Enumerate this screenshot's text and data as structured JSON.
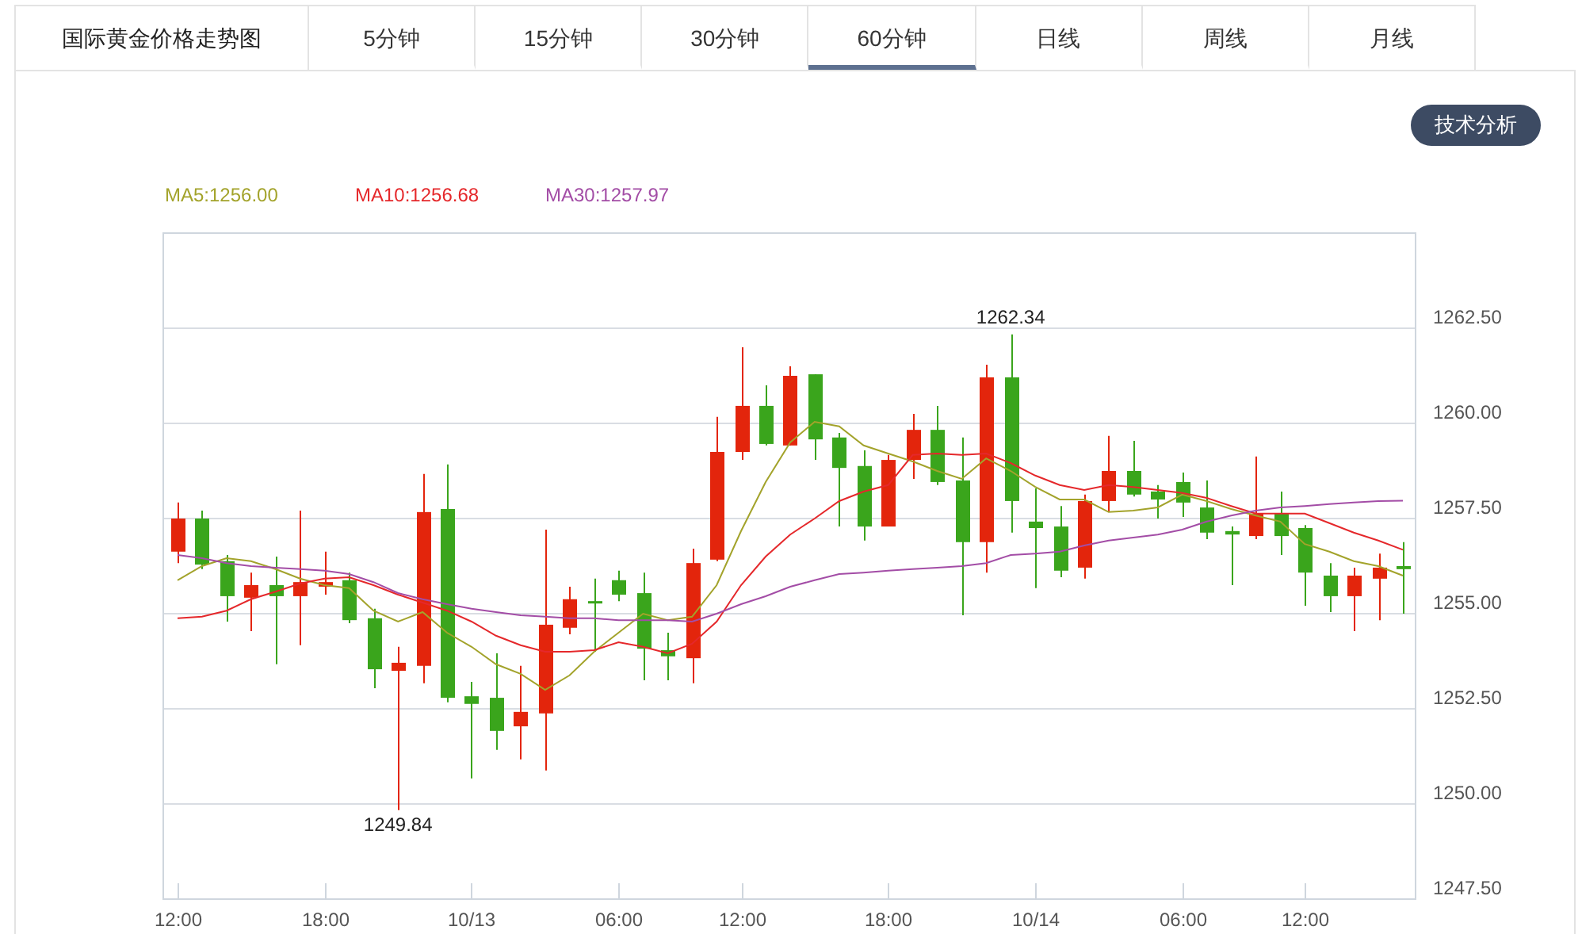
{
  "title": "国际黄金价格走势图",
  "tabs": [
    {
      "label": "5分钟",
      "selected": false
    },
    {
      "label": "15分钟",
      "selected": false
    },
    {
      "label": "30分钟",
      "selected": false
    },
    {
      "label": "60分钟",
      "selected": true
    },
    {
      "label": "日线",
      "selected": false
    },
    {
      "label": "周线",
      "selected": false
    },
    {
      "label": "月线",
      "selected": false
    }
  ],
  "analysis_button": "技术分析",
  "chart_data": {
    "type": "candlestick",
    "ylim": [
      1247.5,
      1265
    ],
    "categories": [
      "12:00",
      null,
      null,
      null,
      null,
      null,
      "18:00",
      null,
      null,
      null,
      null,
      null,
      "10/13",
      null,
      null,
      null,
      null,
      null,
      "06:00",
      null,
      null,
      null,
      null,
      "12:00",
      null,
      null,
      null,
      null,
      null,
      "18:00",
      null,
      null,
      null,
      null,
      null,
      "10/14",
      null,
      null,
      null,
      null,
      null,
      "06:00",
      null,
      null,
      null,
      null,
      "12:00",
      null,
      null,
      null,
      null
    ],
    "yticks": [
      {
        "value": 1262.5,
        "label": "1262.50"
      },
      {
        "value": 1260,
        "label": "1260.00"
      },
      {
        "value": 1257.5,
        "label": "1257.50"
      },
      {
        "value": 1255,
        "label": "1255.00"
      },
      {
        "value": 1252.5,
        "label": "1252.50"
      },
      {
        "value": 1250,
        "label": "1250.00"
      },
      {
        "value": 1247.5,
        "label": "1247.50"
      }
    ],
    "ohlc": [
      [
        1256.63,
        1257.92,
        1256.33,
        1257.5
      ],
      [
        1257.5,
        1257.71,
        1256.17,
        1256.29
      ],
      [
        1256.38,
        1256.54,
        1254.79,
        1255.46
      ],
      [
        1255.42,
        1256.08,
        1254.54,
        1255.75
      ],
      [
        1255.75,
        1256.5,
        1253.67,
        1255.46
      ],
      [
        1255.46,
        1257.71,
        1254.17,
        1255.83
      ],
      [
        1255.71,
        1256.63,
        1255.5,
        1255.83
      ],
      [
        1255.88,
        1256.08,
        1254.75,
        1254.83
      ],
      [
        1254.88,
        1255.13,
        1253.04,
        1253.54
      ],
      [
        1253.5,
        1254.13,
        1249.84,
        1253.71
      ],
      [
        1253.63,
        1258.67,
        1253.17,
        1257.67
      ],
      [
        1257.75,
        1258.92,
        1252.67,
        1252.79
      ],
      [
        1252.83,
        1253.21,
        1250.67,
        1252.63
      ],
      [
        1252.79,
        1253.96,
        1251.42,
        1251.92
      ],
      [
        1252.04,
        1253.63,
        1251.17,
        1252.42
      ],
      [
        1252.38,
        1257.21,
        1250.88,
        1254.71
      ],
      [
        1254.63,
        1255.71,
        1254.46,
        1255.38
      ],
      [
        1255.33,
        1255.92,
        1254.0,
        1255.29
      ],
      [
        1255.88,
        1256.13,
        1255.33,
        1255.5
      ],
      [
        1255.54,
        1256.08,
        1253.25,
        1254.08
      ],
      [
        1254.04,
        1254.5,
        1253.25,
        1253.88
      ],
      [
        1253.83,
        1256.71,
        1253.17,
        1256.33
      ],
      [
        1256.42,
        1260.17,
        1256.38,
        1259.25
      ],
      [
        1259.25,
        1262.0,
        1259.04,
        1260.46
      ],
      [
        1260.46,
        1261.0,
        1259.42,
        1259.46
      ],
      [
        1259.42,
        1261.5,
        1259.42,
        1261.25
      ],
      [
        1261.29,
        1261.29,
        1259.04,
        1259.58
      ],
      [
        1259.63,
        1259.75,
        1257.29,
        1258.83
      ],
      [
        1258.88,
        1259.29,
        1256.92,
        1257.29
      ],
      [
        1257.29,
        1259.17,
        1257.29,
        1259.04
      ],
      [
        1259.04,
        1260.25,
        1258.54,
        1259.83
      ],
      [
        1259.83,
        1260.46,
        1258.38,
        1258.46
      ],
      [
        1258.5,
        1259.63,
        1254.96,
        1256.88
      ],
      [
        1256.88,
        1261.54,
        1256.08,
        1261.21
      ],
      [
        1261.21,
        1262.34,
        1257.13,
        1257.96
      ],
      [
        1257.42,
        1258.29,
        1255.67,
        1257.25
      ],
      [
        1257.29,
        1257.83,
        1255.96,
        1256.13
      ],
      [
        1256.21,
        1258.13,
        1255.92,
        1257.96
      ],
      [
        1257.96,
        1259.67,
        1257.67,
        1258.75
      ],
      [
        1258.75,
        1259.54,
        1258.08,
        1258.13
      ],
      [
        1258.21,
        1258.38,
        1257.5,
        1258.0
      ],
      [
        1258.46,
        1258.71,
        1257.54,
        1257.92
      ],
      [
        1257.79,
        1258.5,
        1256.96,
        1257.13
      ],
      [
        1257.17,
        1257.29,
        1255.75,
        1257.08
      ],
      [
        1257.04,
        1259.13,
        1256.96,
        1257.63
      ],
      [
        1257.63,
        1258.21,
        1256.54,
        1257.04
      ],
      [
        1257.25,
        1257.33,
        1255.21,
        1256.08
      ],
      [
        1256.0,
        1256.33,
        1255.04,
        1255.46
      ],
      [
        1255.46,
        1256.21,
        1254.54,
        1256.0
      ],
      [
        1255.92,
        1256.58,
        1254.83,
        1256.21
      ],
      [
        1256.25,
        1256.88,
        1255.0,
        1256.17
      ]
    ],
    "series": [
      {
        "name": "MA5:1256.00",
        "type": "line",
        "color": "#a3a32b",
        "values": [
          1255.88,
          1256.25,
          1256.46,
          1256.38,
          1256.17,
          1255.92,
          1255.75,
          1255.67,
          1255.08,
          1254.79,
          1255.04,
          1254.5,
          1254.13,
          1253.67,
          1253.42,
          1253.0,
          1253.38,
          1254.0,
          1254.5,
          1255.0,
          1254.83,
          1254.92,
          1255.75,
          1257.17,
          1258.46,
          1259.5,
          1260.04,
          1259.92,
          1259.42,
          1259.21,
          1259.0,
          1258.75,
          1258.54,
          1259.08,
          1258.75,
          1258.33,
          1258.0,
          1258.0,
          1257.67,
          1257.71,
          1257.79,
          1258.13,
          1257.96,
          1257.75,
          1257.58,
          1257.42,
          1256.83,
          1256.63,
          1256.38,
          1256.25,
          1256.0
        ]
      },
      {
        "name": "MA10:1256.68",
        "type": "line",
        "color": "#e5282b",
        "values": [
          1254.88,
          1254.92,
          1255.08,
          1255.38,
          1255.58,
          1255.79,
          1255.92,
          1255.96,
          1255.75,
          1255.5,
          1255.29,
          1255.08,
          1254.79,
          1254.42,
          1254.17,
          1254.0,
          1254.0,
          1254.04,
          1254.25,
          1254.13,
          1253.96,
          1254.21,
          1254.79,
          1255.75,
          1256.5,
          1257.08,
          1257.5,
          1257.96,
          1258.21,
          1258.38,
          1259.17,
          1259.21,
          1259.17,
          1259.21,
          1258.96,
          1258.63,
          1258.38,
          1258.25,
          1258.38,
          1258.33,
          1258.25,
          1258.17,
          1258.04,
          1257.83,
          1257.63,
          1257.63,
          1257.63,
          1257.38,
          1257.13,
          1256.92,
          1256.68
        ]
      },
      {
        "name": "MA30:1257.97",
        "type": "line",
        "color": "#a34da6",
        "values": [
          1256.54,
          1256.46,
          1256.33,
          1256.25,
          1256.21,
          1256.17,
          1256.13,
          1256.04,
          1255.83,
          1255.54,
          1255.38,
          1255.25,
          1255.13,
          1255.04,
          1254.96,
          1254.92,
          1254.88,
          1254.88,
          1254.83,
          1254.83,
          1254.83,
          1254.79,
          1255.0,
          1255.25,
          1255.46,
          1255.71,
          1255.88,
          1256.04,
          1256.08,
          1256.13,
          1256.17,
          1256.21,
          1256.25,
          1256.33,
          1256.54,
          1256.58,
          1256.63,
          1256.79,
          1256.92,
          1257.0,
          1257.08,
          1257.21,
          1257.42,
          1257.58,
          1257.71,
          1257.79,
          1257.83,
          1257.88,
          1257.92,
          1257.96,
          1257.97
        ]
      }
    ],
    "grid": true,
    "annotations": [
      "1262.34",
      "1249.84"
    ]
  }
}
